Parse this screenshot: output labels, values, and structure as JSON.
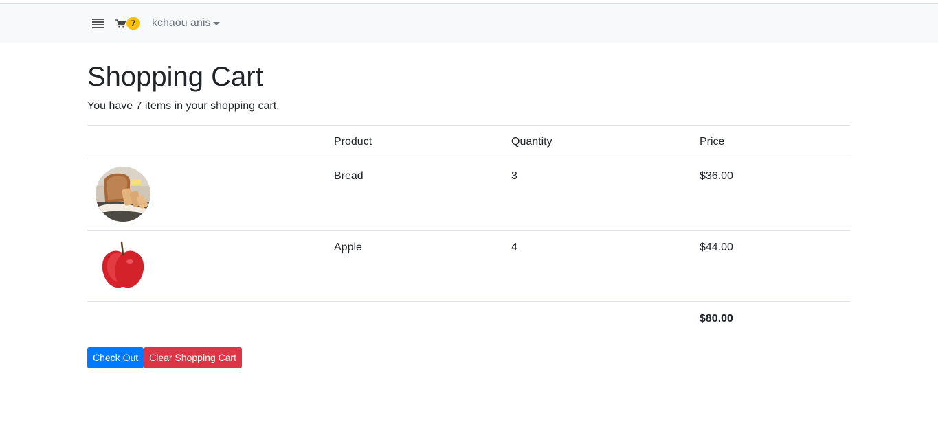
{
  "navbar": {
    "menu_icon": "hamburger-menu-icon",
    "cart_icon": "shopping-cart-icon",
    "cart_count": "7",
    "user_name": "kchaou anis",
    "badge_color": "#ffc107"
  },
  "page": {
    "title": "Shopping Cart",
    "summary": "You have 7 items in your shopping cart."
  },
  "cart_table": {
    "headers": {
      "image": "",
      "product": "Product",
      "quantity": "Quantity",
      "price": "Price"
    },
    "rows": [
      {
        "image": "bread-photo",
        "product": "Bread",
        "quantity": "3",
        "price": "$36.00"
      },
      {
        "image": "apple-photo",
        "product": "Apple",
        "quantity": "4",
        "price": "$44.00"
      }
    ],
    "total": "$80.00"
  },
  "actions": {
    "checkout_label": "Check Out",
    "clear_label": "Clear Shopping Cart",
    "checkout_color": "#007bff",
    "clear_color": "#dc3545"
  }
}
